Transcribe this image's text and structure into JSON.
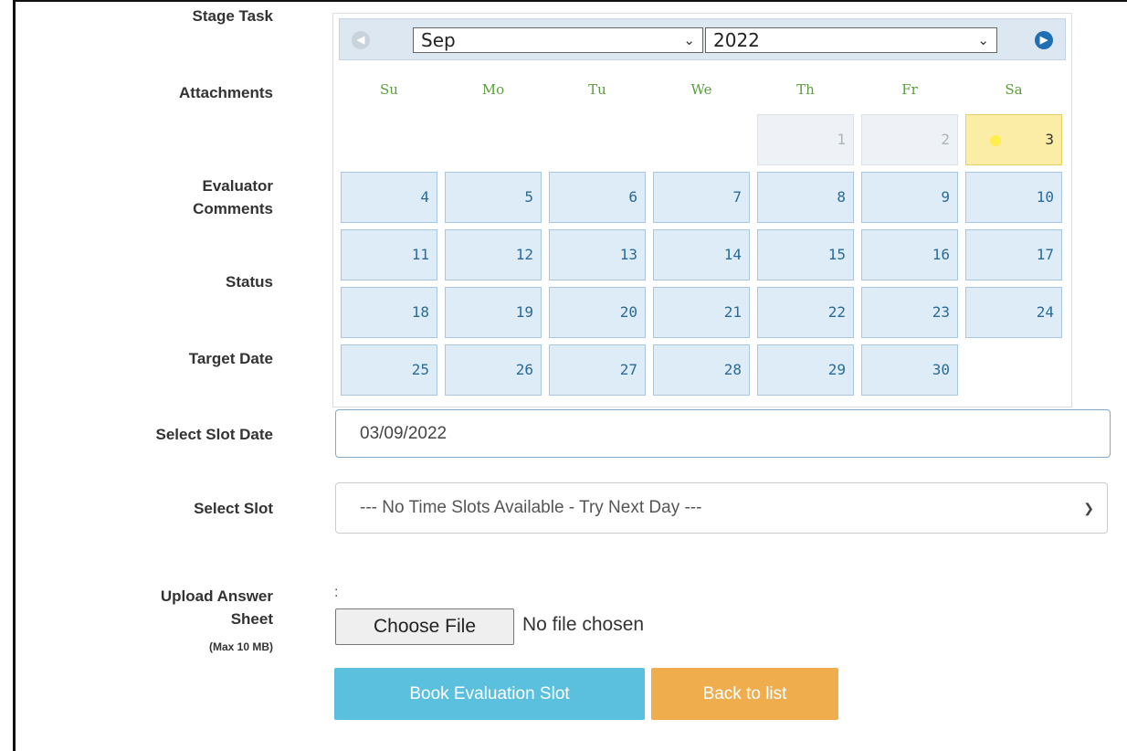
{
  "labels": {
    "stage_task": "Stage Task",
    "attachments": "Attachments",
    "evaluator_comments": [
      "Evaluator",
      "Comments"
    ],
    "status": "Status",
    "target_date": "Target Date",
    "select_slot_date": "Select Slot Date",
    "select_slot": "Select Slot",
    "upload_answer_sheet": [
      "Upload Answer",
      "Sheet"
    ],
    "upload_hint": "(Max 10 MB)"
  },
  "datepicker": {
    "month": "Sep",
    "year": "2022",
    "weekdays": [
      "Su",
      "Mo",
      "Tu",
      "We",
      "Th",
      "Fr",
      "Sa"
    ],
    "weeks": [
      [
        "",
        "",
        "",
        "",
        "1",
        "2",
        "3"
      ],
      [
        "4",
        "5",
        "6",
        "7",
        "8",
        "9",
        "10"
      ],
      [
        "11",
        "12",
        "13",
        "14",
        "15",
        "16",
        "17"
      ],
      [
        "18",
        "19",
        "20",
        "21",
        "22",
        "23",
        "24"
      ],
      [
        "25",
        "26",
        "27",
        "28",
        "29",
        "30",
        ""
      ]
    ],
    "muted_days": [
      "1",
      "2"
    ],
    "selected_day": "3",
    "colors": {
      "header_bg": "#dce7f2",
      "day_bg": "#deecf8",
      "today_bg": "#fbeca6",
      "weekday_text": "#5a9e3c"
    }
  },
  "slot_date_input": {
    "value": "03/09/2022"
  },
  "slot_select": {
    "value": "--- No Time Slots Available - Try Next Day ---"
  },
  "upload": {
    "colon": ":",
    "button_label": "Choose File",
    "status_text": "No file chosen"
  },
  "buttons": {
    "book": "Book Evaluation Slot",
    "back": "Back to list",
    "book_color": "#5bc0de",
    "back_color": "#f0ad4e"
  }
}
